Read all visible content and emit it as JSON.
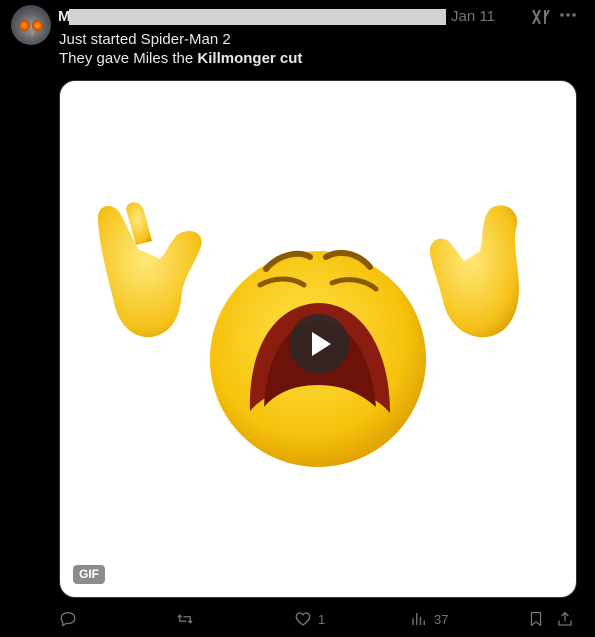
{
  "post": {
    "author_initial": "M",
    "timestamp": "Jan 11",
    "text_line1": "Just started Spider-Man 2",
    "text_line2_prefix": "They gave Miles the ",
    "text_line2_bold": "Killmonger cut",
    "media": {
      "type": "gif",
      "badge": "GIF"
    },
    "actions": {
      "reply_count": "",
      "repost_count": "",
      "like_count": "1",
      "views_count": "37"
    }
  },
  "colors": {
    "background": "#000000",
    "text": "#e7e9ea",
    "muted": "#71767b",
    "emoji_yellow": "#f6c20c"
  },
  "icons": [
    "avatar-owl",
    "grok-icon",
    "more-icon",
    "play-icon",
    "reply-icon",
    "repost-icon",
    "like-icon",
    "views-icon",
    "bookmark-icon",
    "share-icon"
  ]
}
